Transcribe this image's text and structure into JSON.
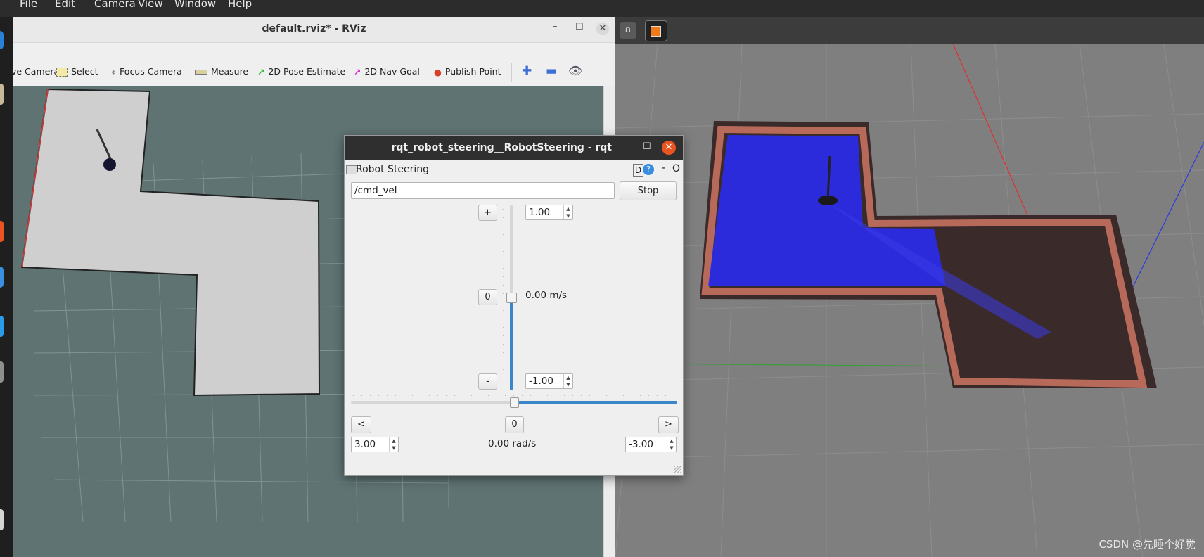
{
  "menu": {
    "items": [
      "File",
      "Edit",
      "Camera",
      "View",
      "Window",
      "Help"
    ]
  },
  "rviz": {
    "window_title": "default.rviz* - RViz",
    "tools": [
      {
        "label": "ve Camera",
        "icon": "move-camera-icon"
      },
      {
        "label": "Select",
        "icon": "select-icon"
      },
      {
        "label": "Focus Camera",
        "icon": "focus-camera-icon"
      },
      {
        "label": "Measure",
        "icon": "measure-icon"
      },
      {
        "label": "2D Pose Estimate",
        "icon": "pose-estimate-arrow-icon"
      },
      {
        "label": "2D Nav Goal",
        "icon": "nav-goal-arrow-icon"
      },
      {
        "label": "Publish Point",
        "icon": "map-pin-icon"
      }
    ]
  },
  "rqt": {
    "window_title": "rqt_robot_steering__RobotSteering - rqt",
    "plugin_title": "Robot Steering",
    "plugin_buttons": {
      "d": "D",
      "help": "?",
      "minimize": "-",
      "close": "O"
    },
    "topic": "/cmd_vel",
    "stop_label": "Stop",
    "linear": {
      "plus_label": "+",
      "zero_label": "0",
      "minus_label": "-",
      "max": "1.00",
      "min": "-1.00",
      "current": "0.00 m/s",
      "slider_fraction": 0.5
    },
    "angular": {
      "left_label": "<",
      "zero_label": "0",
      "right_label": ">",
      "max": "3.00",
      "min": "-3.00",
      "current": "0.00 rad/s",
      "slider_fraction": 0.5
    }
  },
  "watermark": "CSDN @先睡个好觉"
}
